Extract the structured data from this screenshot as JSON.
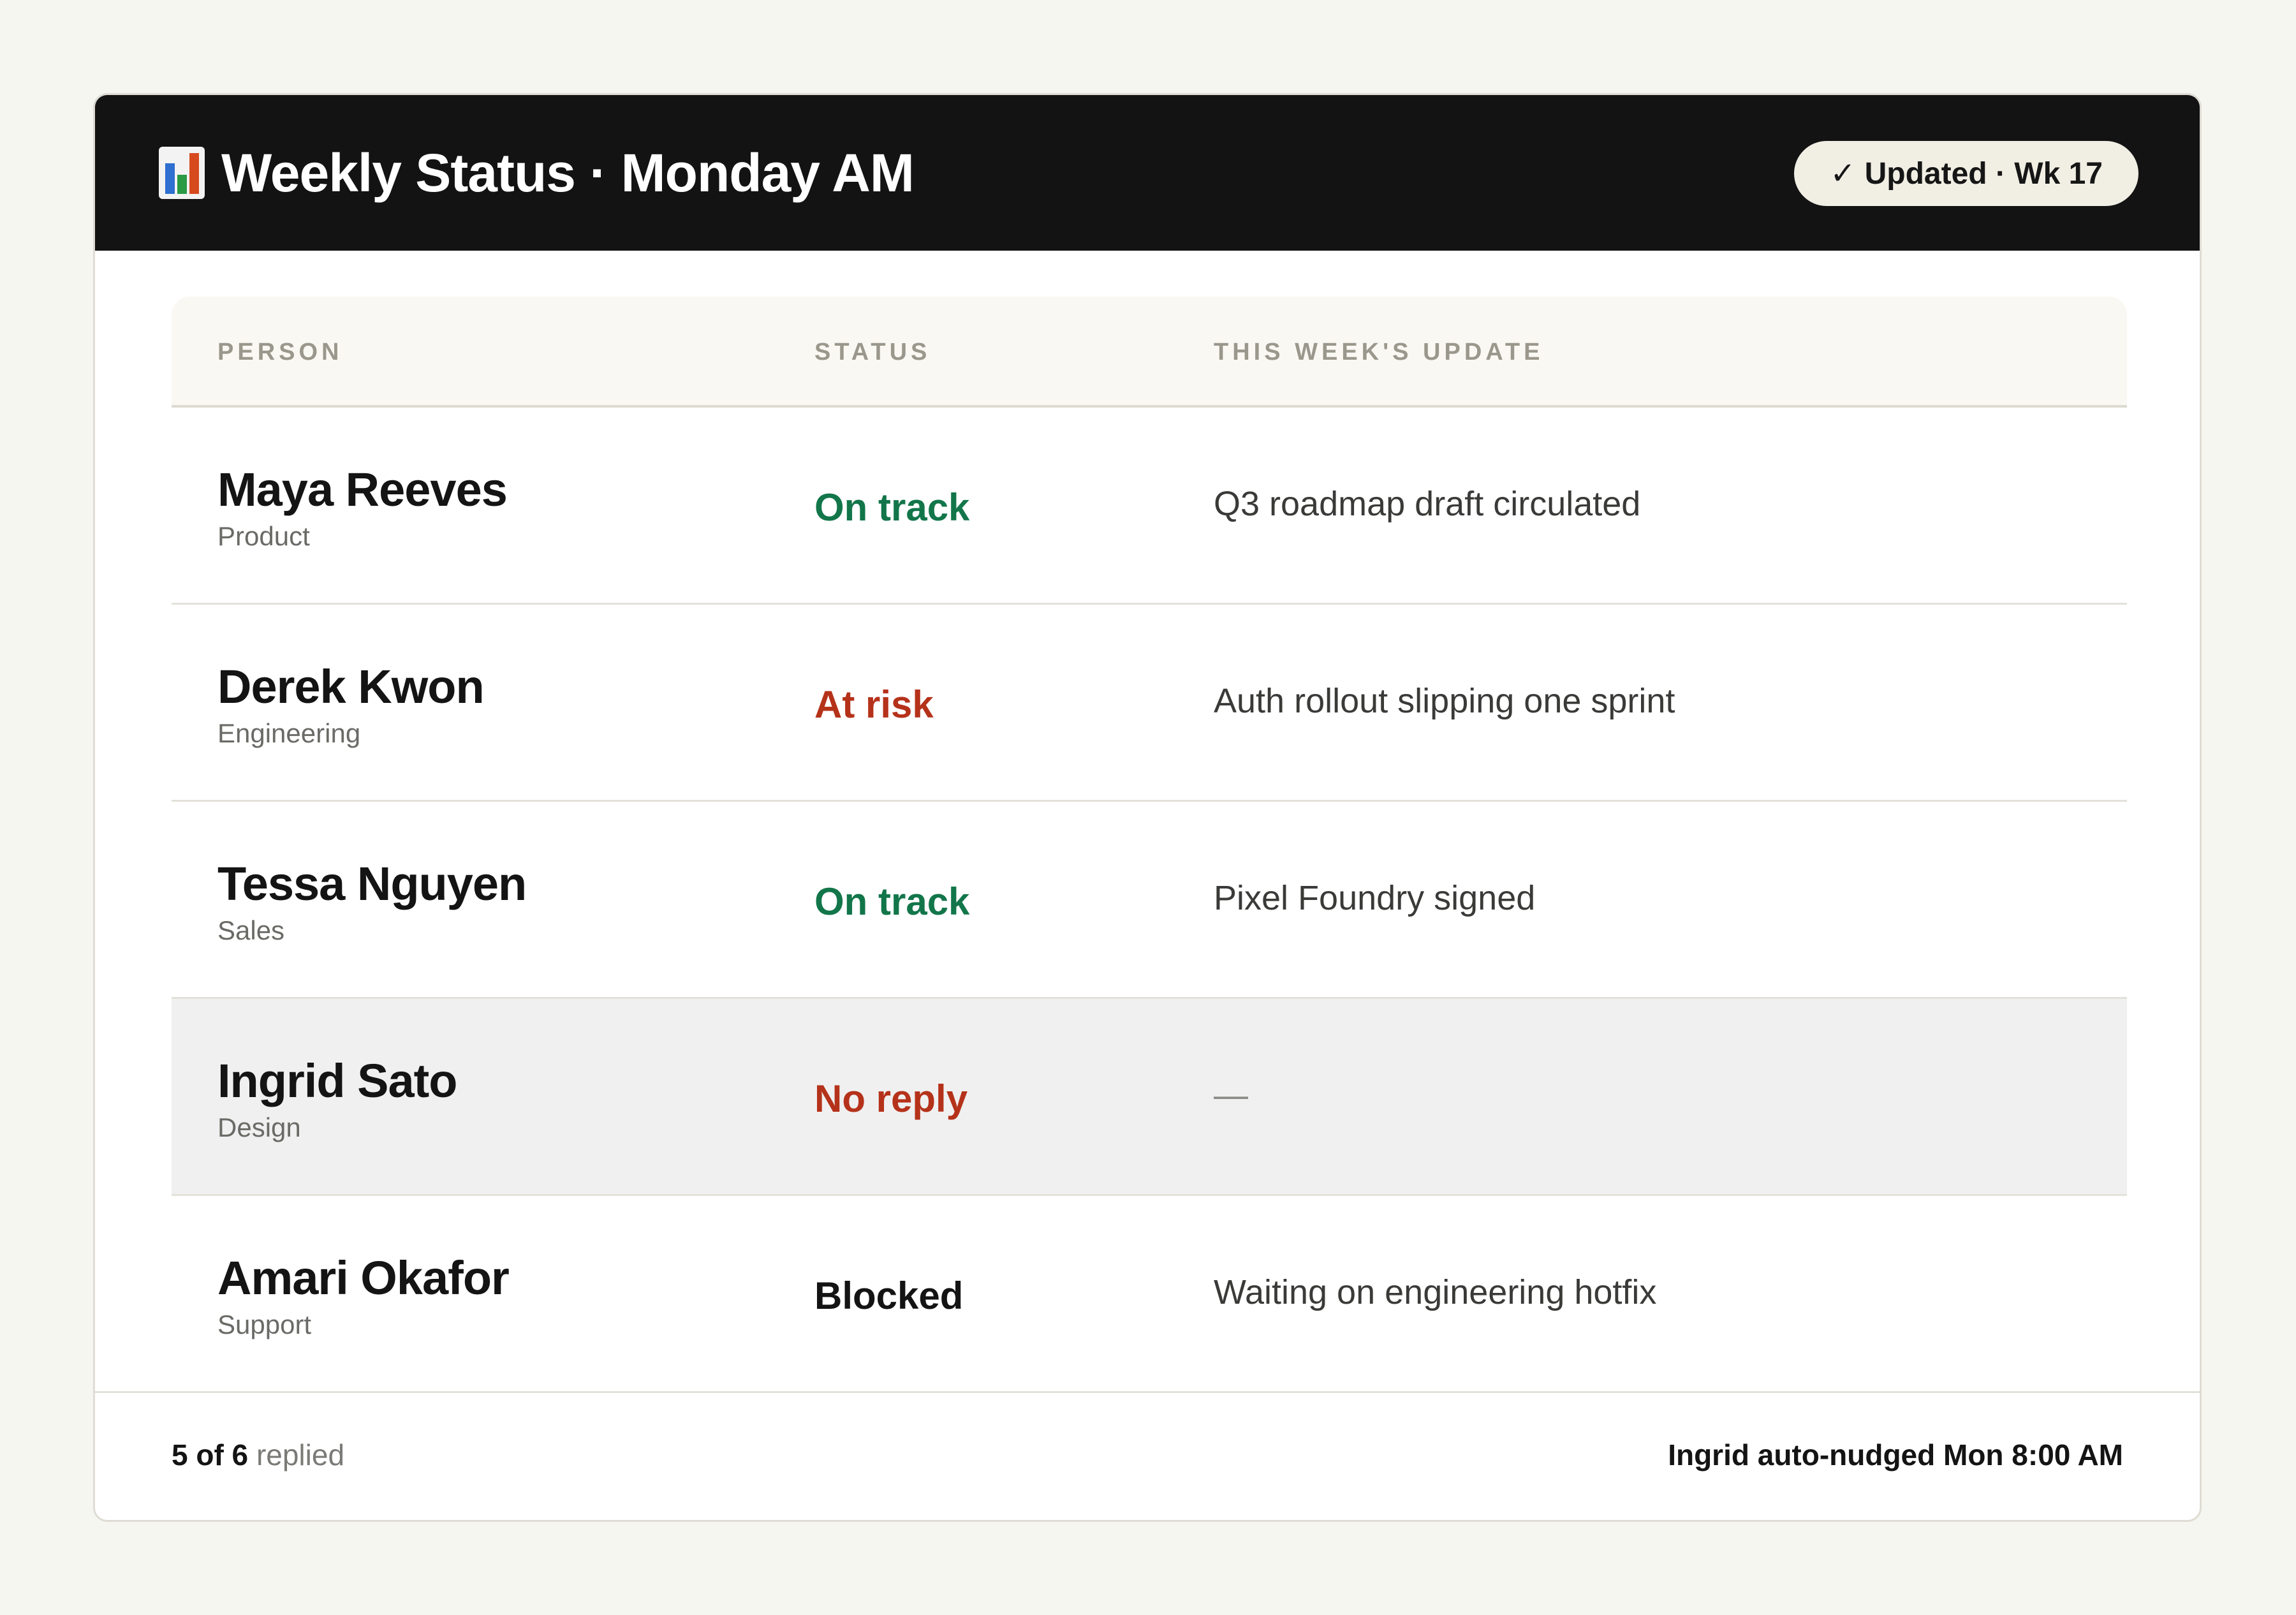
{
  "header": {
    "icon": "bar-chart-icon",
    "title": "Weekly Status · Monday AM",
    "badge": {
      "icon": "check-icon",
      "check_glyph": "✓",
      "label": "Updated · Wk 17"
    }
  },
  "table": {
    "columns": [
      "PERSON",
      "STATUS",
      "THIS WEEK'S UPDATE"
    ],
    "rows": [
      {
        "name": "Maya Reeves",
        "dept": "Product",
        "status": "On track",
        "status_color": "#12764a",
        "update": "Q3 roadmap draft circulated"
      },
      {
        "name": "Derek Kwon",
        "dept": "Engineering",
        "status": "At risk",
        "status_color": "#b5321a",
        "update": "Auth rollout slipping one sprint"
      },
      {
        "name": "Tessa Nguyen",
        "dept": "Sales",
        "status": "On track",
        "status_color": "#12764a",
        "update": "Pixel Foundry signed"
      },
      {
        "name": "Ingrid Sato",
        "dept": "Design",
        "status": "No reply",
        "status_color": "#b5321a",
        "update": "—",
        "highlighted": true
      },
      {
        "name": "Amari Okafor",
        "dept": "Support",
        "status": "Blocked",
        "status_color": "#141414",
        "update": "Waiting on engineering hotfix"
      }
    ]
  },
  "footer": {
    "replied_count": "5 of 6",
    "replied_label": "replied",
    "nudge_text": "Ingrid auto-nudged Mon 8:00 AM"
  }
}
